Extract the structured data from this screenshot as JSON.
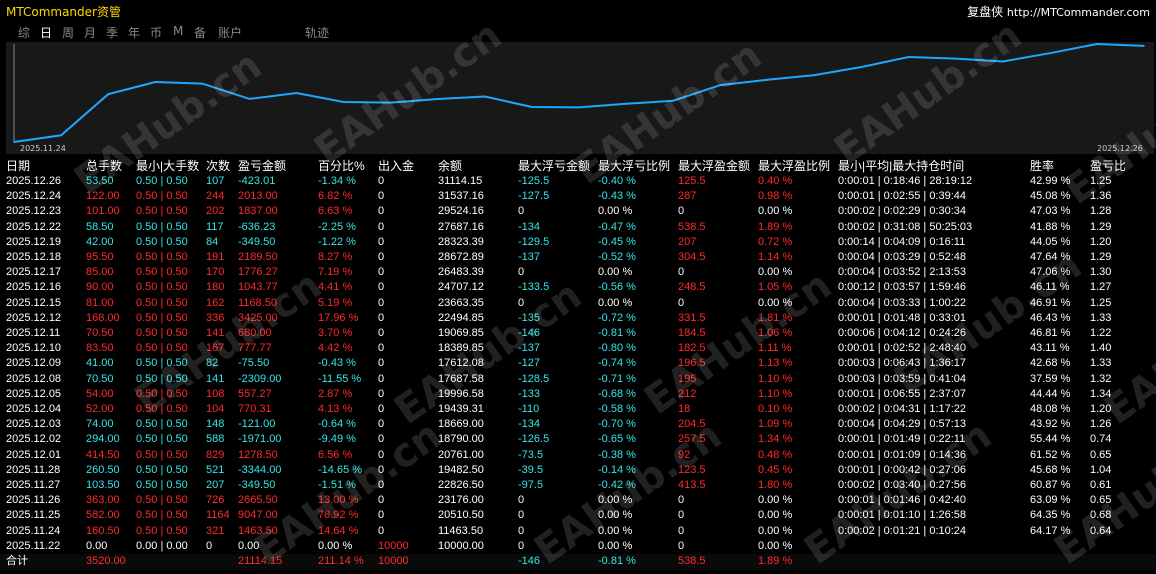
{
  "app": {
    "brand": "MTCommander资管",
    "right_brand": "复盘侠",
    "right_url": "http://MTCommander.com"
  },
  "tabs": [
    "综",
    "日",
    "周",
    "月",
    "季",
    "年",
    "币",
    "M",
    "备",
    "账户",
    "轨迹"
  ],
  "active_tab": "日",
  "watermark": "EAHub.cn",
  "chart_data": {
    "type": "line",
    "x_start_label": "2025.11.24",
    "x_end_label": "2025.12.26",
    "color": "#1ea7ff",
    "x": [
      "2025.11.22",
      "2025.11.24",
      "2025.11.25",
      "2025.11.26",
      "2025.11.27",
      "2025.11.28",
      "2025.12.01",
      "2025.12.02",
      "2025.12.03",
      "2025.12.04",
      "2025.12.05",
      "2025.12.08",
      "2025.12.09",
      "2025.12.10",
      "2025.12.11",
      "2025.12.12",
      "2025.12.15",
      "2025.12.16",
      "2025.12.17",
      "2025.12.18",
      "2025.12.19",
      "2025.12.22",
      "2025.12.23",
      "2025.12.24",
      "2025.12.26"
    ],
    "values": [
      10000.0,
      11463.5,
      20510.5,
      23176.0,
      22826.5,
      19482.5,
      20761.0,
      18790.0,
      18669.0,
      19439.31,
      19996.58,
      17687.58,
      17612.08,
      18389.85,
      19069.85,
      22494.85,
      23663.35,
      24707.12,
      26483.39,
      28672.89,
      28323.39,
      27687.16,
      29524.16,
      31537.16,
      31114.15
    ]
  },
  "table": {
    "headers": [
      "日期",
      "总手数",
      "最小|大手数",
      "次数",
      "盈亏金额",
      "百分比%",
      "出入金",
      "余额",
      "最大浮亏金额",
      "最大浮亏比例",
      "最大浮盈金额",
      "最大浮盈比例",
      "最小|平均|最大持仓时间",
      "胜率",
      "盈亏比"
    ],
    "rows": [
      {
        "t": "g",
        "c": [
          "2025.12.26",
          "53.50",
          "0.50 | 0.50",
          "107",
          "-423.01",
          "-1.34 %",
          "0",
          "31114.15",
          "-125.5",
          "-0.40 %",
          "125.5",
          "0.40 %",
          "0:00:01 | 0:18:46 | 28:19:12",
          "42.99 %",
          "1.25"
        ]
      },
      {
        "t": "r",
        "c": [
          "2025.12.24",
          "122.00",
          "0.50 | 0.50",
          "244",
          "2013.00",
          "6.82 %",
          "0",
          "31537.16",
          "-127.5",
          "-0.43 %",
          "287",
          "0.98 %",
          "0:00:01 | 0:02:55 | 0:39:44",
          "45.08 %",
          "1.36"
        ]
      },
      {
        "t": "r",
        "c": [
          "2025.12.23",
          "101.00",
          "0.50 | 0.50",
          "202",
          "1837.00",
          "6.63 %",
          "0",
          "29524.16",
          "0",
          "0.00 %",
          "0",
          "0.00 %",
          "0:00:02 | 0:02:29 | 0:30:34",
          "47.03 %",
          "1.28"
        ]
      },
      {
        "t": "g",
        "c": [
          "2025.12.22",
          "58.50",
          "0.50 | 0.50",
          "117",
          "-636.23",
          "-2.25 %",
          "0",
          "27687.16",
          "-134",
          "-0.47 %",
          "538.5",
          "1.89 %",
          "0:00:02 | 0:31:08 | 50:25:03",
          "41.88 %",
          "1.29"
        ]
      },
      {
        "t": "g",
        "c": [
          "2025.12.19",
          "42.00",
          "0.50 | 0.50",
          "84",
          "-349.50",
          "-1.22 %",
          "0",
          "28323.39",
          "-129.5",
          "-0.45 %",
          "207",
          "0.72 %",
          "0:00:14 | 0:04:09 | 0:16:11",
          "44.05 %",
          "1.20"
        ]
      },
      {
        "t": "r",
        "c": [
          "2025.12.18",
          "95.50",
          "0.50 | 0.50",
          "191",
          "2189.50",
          "8.27 %",
          "0",
          "28672.89",
          "-137",
          "-0.52 %",
          "304.5",
          "1.14 %",
          "0:00:04 | 0:03:29 | 0:52:48",
          "47.64 %",
          "1.29"
        ]
      },
      {
        "t": "r",
        "c": [
          "2025.12.17",
          "85.00",
          "0.50 | 0.50",
          "170",
          "1776.27",
          "7.19 %",
          "0",
          "26483.39",
          "0",
          "0.00 %",
          "0",
          "0.00 %",
          "0:00:04 | 0:03:52 | 2:13:53",
          "47.06 %",
          "1.30"
        ]
      },
      {
        "t": "r",
        "c": [
          "2025.12.16",
          "90.00",
          "0.50 | 0.50",
          "180",
          "1043.77",
          "4.41 %",
          "0",
          "24707.12",
          "-133.5",
          "-0.56 %",
          "248.5",
          "1.05 %",
          "0:00:12 | 0:03:57 | 1:59:46",
          "46.11 %",
          "1.27"
        ]
      },
      {
        "t": "r",
        "c": [
          "2025.12.15",
          "81.00",
          "0.50 | 0.50",
          "162",
          "1168.50",
          "5.19 %",
          "0",
          "23663.35",
          "0",
          "0.00 %",
          "0",
          "0.00 %",
          "0:00:04 | 0:03:33 | 1:00:22",
          "46.91 %",
          "1.25"
        ]
      },
      {
        "t": "r",
        "c": [
          "2025.12.12",
          "168.00",
          "0.50 | 0.50",
          "336",
          "3425.00",
          "17.96 %",
          "0",
          "22494.85",
          "-135",
          "-0.72 %",
          "331.5",
          "1.81 %",
          "0:00:01 | 0:01:48 | 0:33:01",
          "46.43 %",
          "1.33"
        ]
      },
      {
        "t": "r",
        "c": [
          "2025.12.11",
          "70.50",
          "0.50 | 0.50",
          "141",
          "680.00",
          "3.70 %",
          "0",
          "19069.85",
          "-146",
          "-0.81 %",
          "184.5",
          "1.06 %",
          "0:00:06 | 0:04:12 | 0:24:26",
          "46.81 %",
          "1.22"
        ]
      },
      {
        "t": "r",
        "c": [
          "2025.12.10",
          "83.50",
          "0.50 | 0.50",
          "167",
          "777.77",
          "4.42 %",
          "0",
          "18389.85",
          "-137",
          "-0.80 %",
          "182.5",
          "1.11 %",
          "0:00:01 | 0:02:52 | 2:48:40",
          "43.11 %",
          "1.40"
        ]
      },
      {
        "t": "g",
        "c": [
          "2025.12.09",
          "41.00",
          "0.50 | 0.50",
          "82",
          "-75.50",
          "-0.43 %",
          "0",
          "17612.08",
          "-127",
          "-0.74 %",
          "196.5",
          "1.13 %",
          "0:00:03 | 0:06:43 | 1:36:17",
          "42.68 %",
          "1.33"
        ]
      },
      {
        "t": "g",
        "c": [
          "2025.12.08",
          "70.50",
          "0.50 | 0.50",
          "141",
          "-2309.00",
          "-11.55 %",
          "0",
          "17687.58",
          "-128.5",
          "-0.71 %",
          "195",
          "1.10 %",
          "0:00:03 | 0:03:59 | 0:41:04",
          "37.59 %",
          "1.32"
        ]
      },
      {
        "t": "r",
        "c": [
          "2025.12.05",
          "54.00",
          "0.50 | 0.50",
          "108",
          "557.27",
          "2.87 %",
          "0",
          "19996.58",
          "-133",
          "-0.68 %",
          "212",
          "1.10 %",
          "0:00:01 | 0:06:55 | 2:37:07",
          "44.44 %",
          "1.34"
        ]
      },
      {
        "t": "r",
        "c": [
          "2025.12.04",
          "52.00",
          "0.50 | 0.50",
          "104",
          "770.31",
          "4.13 %",
          "0",
          "19439.31",
          "-110",
          "-0.58 %",
          "18",
          "0.10 %",
          "0:00:02 | 0:04:31 | 1:17:22",
          "48.08 %",
          "1.20"
        ]
      },
      {
        "t": "g",
        "c": [
          "2025.12.03",
          "74.00",
          "0.50 | 0.50",
          "148",
          "-121.00",
          "-0.64 %",
          "0",
          "18669.00",
          "-134",
          "-0.70 %",
          "204.5",
          "1.09 %",
          "0:00:04 | 0:04:29 | 0:57:13",
          "43.92 %",
          "1.26"
        ]
      },
      {
        "t": "g",
        "c": [
          "2025.12.02",
          "294.00",
          "0.50 | 0.50",
          "588",
          "-1971.00",
          "-9.49 %",
          "0",
          "18790.00",
          "-126.5",
          "-0.65 %",
          "257.5",
          "1.34 %",
          "0:00:01 | 0:01:49 | 0:22:11",
          "55.44 %",
          "0.74"
        ]
      },
      {
        "t": "r",
        "c": [
          "2025.12.01",
          "414.50",
          "0.50 | 0.50",
          "829",
          "1278.50",
          "6.56 %",
          "0",
          "20761.00",
          "-73.5",
          "-0.38 %",
          "92",
          "0.48 %",
          "0:00:01 | 0:01:09 | 0:14:36",
          "61.52 %",
          "0.65"
        ]
      },
      {
        "t": "g",
        "c": [
          "2025.11.28",
          "260.50",
          "0.50 | 0.50",
          "521",
          "-3344.00",
          "-14.65 %",
          "0",
          "19482.50",
          "-39.5",
          "-0.14 %",
          "123.5",
          "0.45 %",
          "0:00:01 | 0:00:42 | 0:27:06",
          "45.68 %",
          "1.04"
        ]
      },
      {
        "t": "g",
        "c": [
          "2025.11.27",
          "103.50",
          "0.50 | 0.50",
          "207",
          "-349.50",
          "-1.51 %",
          "0",
          "22826.50",
          "-97.5",
          "-0.42 %",
          "413.5",
          "1.80 %",
          "0:00:02 | 0:03:40 | 0:27:56",
          "60.87 %",
          "0.61"
        ]
      },
      {
        "t": "r",
        "c": [
          "2025.11.26",
          "363.00",
          "0.50 | 0.50",
          "726",
          "2665.50",
          "13.00 %",
          "0",
          "23176.00",
          "0",
          "0.00 %",
          "0",
          "0.00 %",
          "0:00:01 | 0:01:46 | 0:42:40",
          "63.09 %",
          "0.65"
        ]
      },
      {
        "t": "r",
        "c": [
          "2025.11.25",
          "582.00",
          "0.50 | 0.50",
          "1164",
          "9047.00",
          "78.92 %",
          "0",
          "20510.50",
          "0",
          "0.00 %",
          "0",
          "0.00 %",
          "0:00:01 | 0:01:10 | 1:26:58",
          "64.35 %",
          "0.68"
        ]
      },
      {
        "t": "r",
        "c": [
          "2025.11.24",
          "160.50",
          "0.50 | 0.50",
          "321",
          "1463.50",
          "14.64 %",
          "0",
          "11463.50",
          "0",
          "0.00 %",
          "0",
          "0.00 %",
          "0:00:02 | 0:01:21 | 0:10:24",
          "64.17 %",
          "0.64"
        ]
      },
      {
        "t": "w",
        "c": [
          "2025.11.22",
          "0.00",
          "0.00 | 0.00",
          "0",
          "0.00",
          "0.00 %",
          "10000",
          "10000.00",
          "0",
          "0.00 %",
          "0",
          "0.00 %",
          "",
          "",
          ""
        ]
      }
    ],
    "total": [
      "合计",
      "3520.00",
      "",
      "",
      "21114.15",
      "211.14 %",
      "10000",
      "",
      "-146",
      "-0.81 %",
      "538.5",
      "1.89 %",
      "",
      "",
      ""
    ]
  }
}
